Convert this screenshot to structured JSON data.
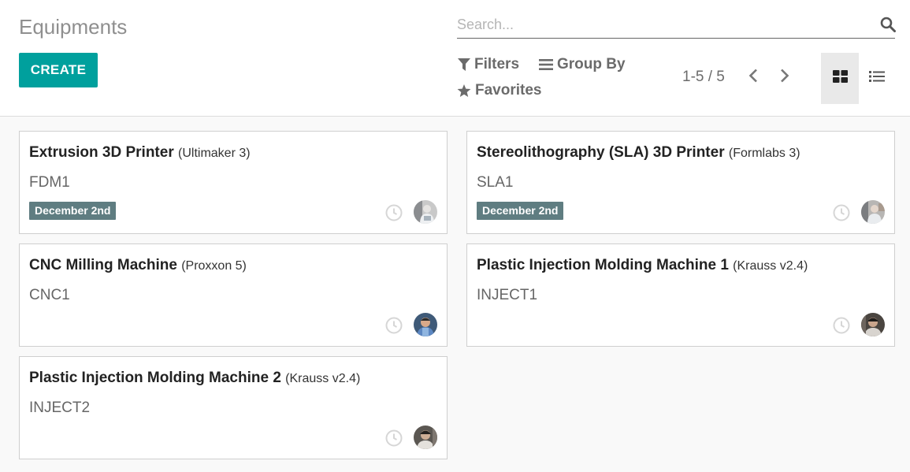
{
  "title": "Equipments",
  "create_label": "CREATE",
  "search": {
    "placeholder": "Search..."
  },
  "filters": {
    "filters_label": "Filters",
    "group_by_label": "Group By",
    "favorites_label": "Favorites"
  },
  "pager": {
    "value": "1-5 / 5"
  },
  "views": {
    "active": "kanban"
  },
  "colors": {
    "accent": "#00a09d",
    "badge": "#5f7d81"
  },
  "cards": [
    {
      "name": "Extrusion 3D Printer",
      "model": "(Ultimaker 3)",
      "ref": "FDM1",
      "date": "December 2nd",
      "avatar": "avatar-photo"
    },
    {
      "name": "Stereolithography (SLA) 3D Printer",
      "model": "(Formlabs 3)",
      "ref": "SLA1",
      "date": "December 2nd",
      "avatar": "avatar-photo"
    },
    {
      "name": "CNC Milling Machine",
      "model": "(Proxxon 5)",
      "ref": "CNC1",
      "date": "",
      "avatar": "avatar-photo"
    },
    {
      "name": "Plastic Injection Molding Machine 1",
      "model": "(Krauss v2.4)",
      "ref": "INJECT1",
      "date": "",
      "avatar": "avatar-photo"
    },
    {
      "name": "Plastic Injection Molding Machine 2",
      "model": "(Krauss v2.4)",
      "ref": "INJECT2",
      "date": "",
      "avatar": "avatar-photo"
    }
  ]
}
